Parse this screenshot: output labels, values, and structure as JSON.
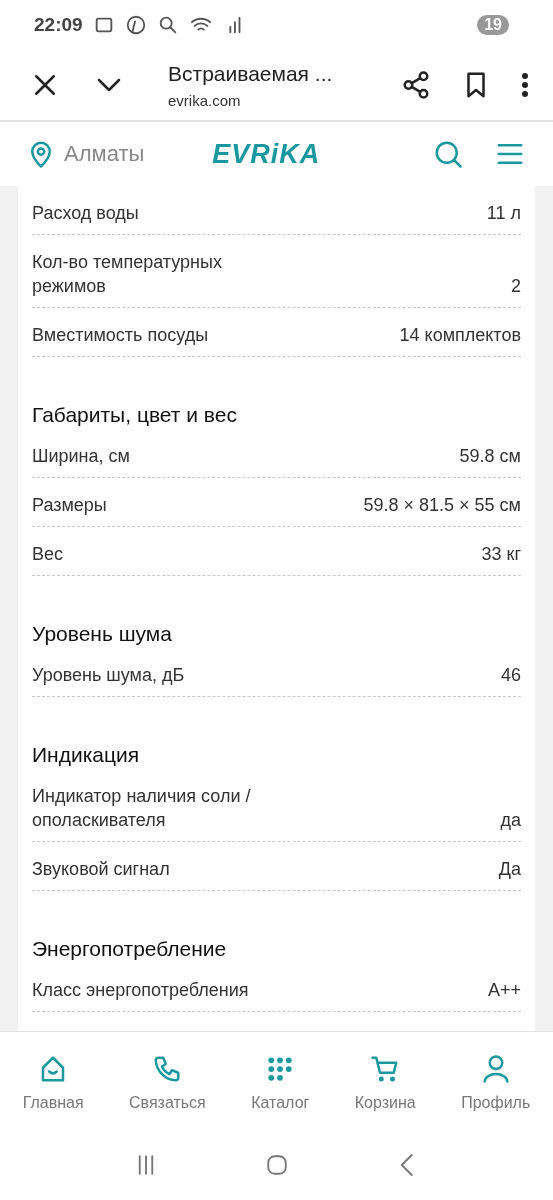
{
  "status_bar": {
    "time": "22:09",
    "battery": "19"
  },
  "browser": {
    "title": "Встраиваемая ...",
    "url": "evrika.com"
  },
  "site_header": {
    "city": "Алматы",
    "logo": "EVRiKA"
  },
  "sections": [
    {
      "rows": [
        {
          "label": "Расход воды",
          "value": "11 л"
        },
        {
          "label": "Кол-во температурных режимов",
          "value": "2"
        },
        {
          "label": "Вместимость посуды",
          "value": "14 комплектов"
        }
      ]
    },
    {
      "title": "Габариты, цвет и вес",
      "rows": [
        {
          "label": "Ширина, см",
          "value": "59.8 см"
        },
        {
          "label": "Размеры",
          "value": "59.8 × 81.5 × 55 см"
        },
        {
          "label": "Вес",
          "value": "33 кг"
        }
      ]
    },
    {
      "title": "Уровень шума",
      "rows": [
        {
          "label": "Уровень шума, дБ",
          "value": "46"
        }
      ]
    },
    {
      "title": "Индикация",
      "rows": [
        {
          "label": "Индикатор наличия соли / ополаскивателя",
          "value": "да"
        },
        {
          "label": "Звуковой сигнал",
          "value": "Да"
        }
      ]
    },
    {
      "title": "Энергопотребление",
      "rows": [
        {
          "label": "Класс энергопотребления",
          "value": "A++"
        }
      ]
    }
  ],
  "bottom_nav": [
    {
      "kind": "home",
      "label": "Главная"
    },
    {
      "kind": "phone",
      "label": "Связаться"
    },
    {
      "kind": "catalog",
      "label": "Каталог"
    },
    {
      "kind": "cart",
      "label": "Корзина"
    },
    {
      "kind": "profile",
      "label": "Профиль"
    }
  ]
}
